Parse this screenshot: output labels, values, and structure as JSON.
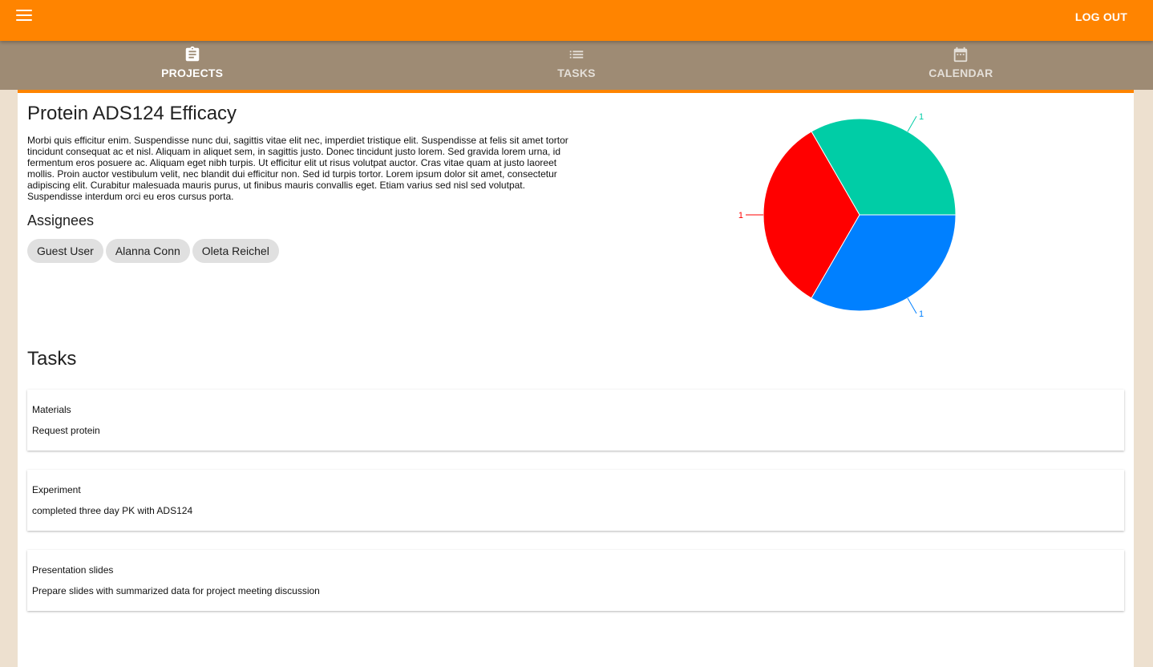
{
  "header": {
    "menu_icon": "hamburger-menu-icon",
    "logout_label": "LOG OUT",
    "color": "#ff8400"
  },
  "tabs": [
    {
      "label": "PROJECTS",
      "icon": "clipboard-icon",
      "active": true
    },
    {
      "label": "TASKS",
      "icon": "list-icon",
      "active": false
    },
    {
      "label": "CALENDAR",
      "icon": "calendar-icon",
      "active": false
    }
  ],
  "project": {
    "title": "Protein ADS124 Efficacy",
    "description": "Morbi quis efficitur enim. Suspendisse nunc dui, sagittis vitae elit nec, imperdiet tristique elit. Suspendisse at felis sit amet tortor tincidunt consequat ac et nisl. Aliquam in aliquet sem, in sagittis justo. Donec tincidunt justo lorem. Sed gravida lorem urna, id fermentum eros posuere ac. Aliquam eget nibh turpis. Ut efficitur elit ut risus volutpat auctor. Cras vitae quam at justo laoreet mollis. Proin auctor vestibulum velit, nec blandit dui efficitur non. Sed id turpis tortor. Lorem ipsum dolor sit amet, consectetur adipiscing elit. Curabitur malesuada mauris purus, ut finibus mauris convallis eget. Etiam varius sed nisl sed volutpat. Suspendisse interdum orci eu eros cursus porta.",
    "assignees_heading": "Assignees",
    "assignees": [
      "Guest User",
      "Alanna Conn",
      "Oleta Reichel"
    ]
  },
  "chart_data": {
    "type": "pie",
    "slices": [
      {
        "value": 1,
        "label": "1",
        "color": "#00cda6"
      },
      {
        "value": 1,
        "label": "1",
        "color": "#ff0000"
      },
      {
        "value": 1,
        "label": "1",
        "color": "#0080ff"
      }
    ]
  },
  "tasks_section": {
    "heading": "Tasks",
    "items": [
      {
        "title": "Materials",
        "description": "Request protein"
      },
      {
        "title": "Experiment",
        "description": "completed three day PK with ADS124"
      },
      {
        "title": "Presentation slides",
        "description": "Prepare slides with summarized data for project meeting discussion"
      }
    ]
  }
}
